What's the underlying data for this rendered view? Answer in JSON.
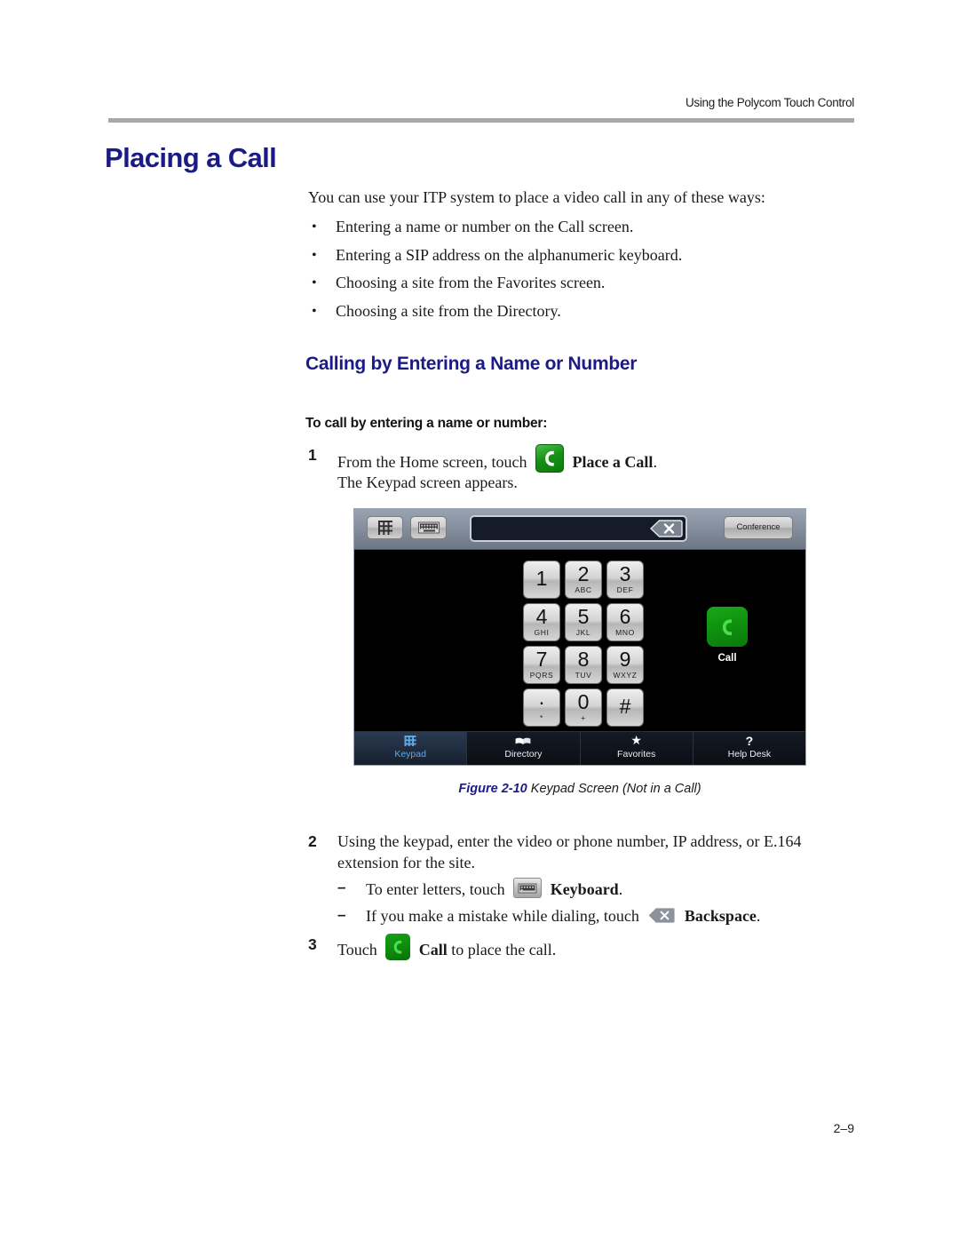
{
  "header": {
    "running_head": "Using the Polycom Touch Control"
  },
  "chapter": {
    "title": "Placing a Call",
    "title_color": "#1b1b87"
  },
  "intro": {
    "paragraph": "You can use your ITP system to place a video call in any of these ways:",
    "bullets": [
      "Entering a name or number on the Call screen.",
      "Entering a SIP address on the alphanumeric keyboard.",
      "Choosing a site from the Favorites screen.",
      "Choosing a site from the Directory."
    ]
  },
  "section": {
    "heading": "Calling by Entering a Name or Number",
    "procedure_heading": "To call by entering a name or number:"
  },
  "steps": {
    "step1": {
      "number": "1",
      "text_before": "From the Home screen, touch",
      "icon_label": "Place a Call",
      "text_after": ".",
      "result": "The Keypad screen appears."
    },
    "step2": {
      "number": "2",
      "line1": "Using the keypad, enter the video or phone number, IP address, or E.164",
      "line2": "extension for the site.",
      "substeps": [
        {
          "dash": "–",
          "text_before": "To enter letters, touch",
          "icon_label": "Keyboard",
          "text_after": "."
        },
        {
          "dash": "–",
          "text_before": "If you make a mistake while dialing, touch",
          "icon_label": "Backspace",
          "text_after": "."
        }
      ]
    },
    "step3": {
      "number": "3",
      "text_before": "Touch",
      "icon_label": "Call",
      "text_after": "to place the call."
    }
  },
  "figure": {
    "caption_number": "Figure 2-10",
    "caption_title": "Keypad Screen (Not in a Call)",
    "screen": {
      "toolbar": {
        "keypad_button_icon": "keypad-grid-icon",
        "keyboard_button_icon": "keyboard-icon",
        "dial_field_value": "",
        "backspace_icon": "backspace-icon",
        "conference_label": "Conference"
      },
      "keys": [
        {
          "digit": "1",
          "letters": ""
        },
        {
          "digit": "2",
          "letters": "ABC"
        },
        {
          "digit": "3",
          "letters": "DEF"
        },
        {
          "digit": "4",
          "letters": "GHI"
        },
        {
          "digit": "5",
          "letters": "JKL"
        },
        {
          "digit": "6",
          "letters": "MNO"
        },
        {
          "digit": "7",
          "letters": "PQRS"
        },
        {
          "digit": "8",
          "letters": "TUV"
        },
        {
          "digit": "9",
          "letters": "WXYZ"
        },
        {
          "digit": "·",
          "letters": "*"
        },
        {
          "digit": "0",
          "letters": "+"
        },
        {
          "digit": "#",
          "letters": ""
        }
      ],
      "call_button": {
        "label": "Call",
        "color": "#0f900f"
      },
      "bottom_nav": [
        {
          "label": "Keypad",
          "icon": "keypad-grid-icon",
          "active": true
        },
        {
          "label": "Directory",
          "icon": "book-icon",
          "active": false
        },
        {
          "label": "Favorites",
          "icon": "star-icon",
          "active": false
        },
        {
          "label": "Help Desk",
          "icon": "question-mark-icon",
          "active": false
        }
      ],
      "active_tab_color": "#5fa8e8"
    }
  },
  "footer": {
    "page_number": "2–9"
  }
}
